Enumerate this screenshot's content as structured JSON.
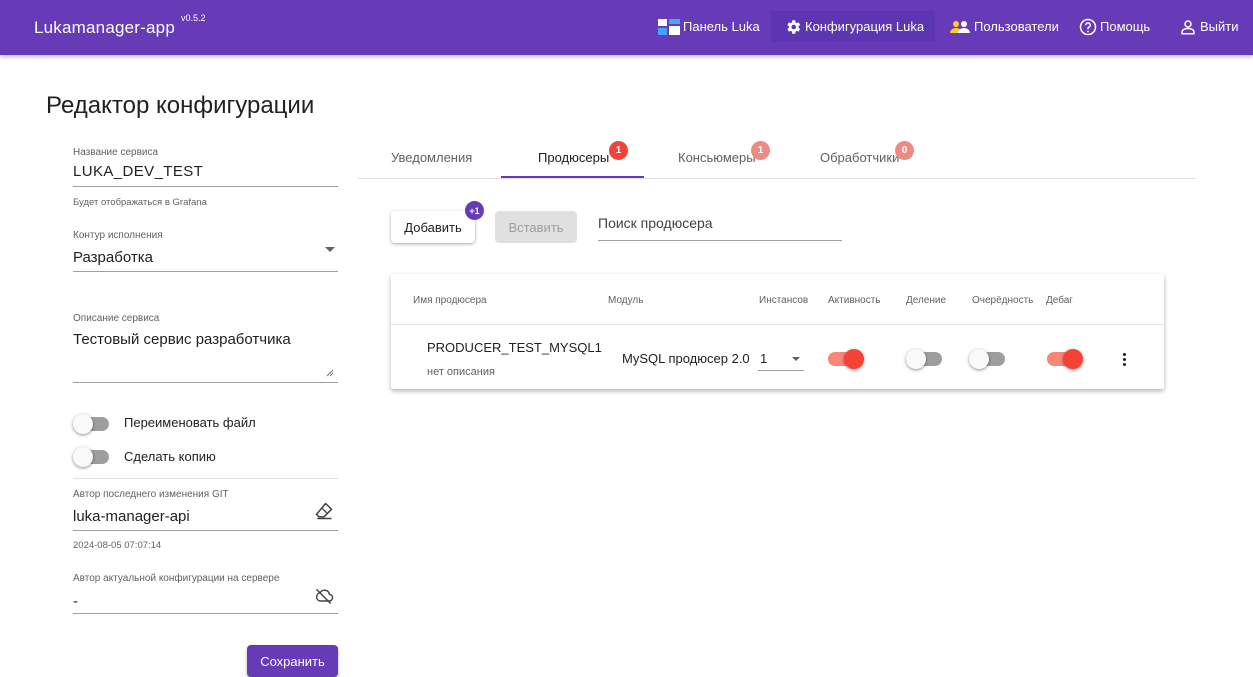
{
  "appbar": {
    "title": "Lukamanager-app",
    "version": "v0.5.2",
    "nav": {
      "dashboard": "Панель Luka",
      "config": "Конфигурация Luka",
      "users": "Пользователи",
      "help": "Помощь",
      "logout": "Выйти"
    }
  },
  "page": {
    "title": "Редактор конфигурации"
  },
  "form": {
    "service_name_label": "Название сервиса",
    "service_name_value": "LUKA_DEV_TEST",
    "service_name_hint": "Будет отображаться в Grafana",
    "contour_label": "Контур исполнения",
    "contour_value": "Разработка",
    "description_label": "Описание сервиса",
    "description_value": "Тестовый сервис разработчика",
    "rename_file_label": "Переименовать файл",
    "rename_file_on": false,
    "make_copy_label": "Сделать копию",
    "make_copy_on": false,
    "git_author_label": "Автор последнего изменения GIT",
    "git_author_value": "luka-manager-api",
    "git_date": "2024-08-05 07:07:14",
    "server_author_label": "Автор актуальной конфигурации на сервере",
    "server_author_value": "-",
    "save_label": "Сохранить"
  },
  "tabs": [
    {
      "label": "Уведомления",
      "badge": null
    },
    {
      "label": "Продюсеры",
      "badge": "1"
    },
    {
      "label": "Консьюмеры",
      "badge": "1"
    },
    {
      "label": "Обработчики",
      "badge": "0"
    }
  ],
  "toolbar": {
    "add_label": "Добавить",
    "add_badge": "+1",
    "paste_label": "Вставить",
    "search_placeholder": "Поиск продюсера"
  },
  "table": {
    "columns": [
      "Имя продюсера",
      "Модуль",
      "Инстансов",
      "Активность",
      "Деление",
      "Очерёдность",
      "Дебаг"
    ],
    "rows": [
      {
        "name": "PRODUCER_TEST_MYSQL1",
        "description": "нет описания",
        "module": "MySQL продюсер 2.0",
        "instances": "1",
        "active": true,
        "division": false,
        "ordering": false,
        "debug": true
      }
    ]
  },
  "colors": {
    "primary": "#673ab7",
    "badge_red": "#f44336",
    "badge_light": "#ef8a80",
    "switch_on": "#f44336"
  },
  "icons": {
    "dashboard": "dashboard-icon",
    "config": "gear-icon",
    "users": "users-icon",
    "help": "help-circle-icon",
    "logout": "user-outline-icon",
    "git": "eraser-icon",
    "server": "cloud-off-icon"
  }
}
